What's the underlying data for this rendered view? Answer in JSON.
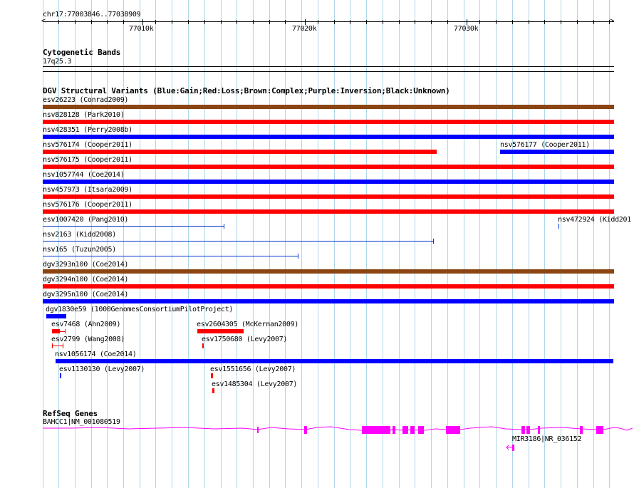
{
  "location": "chr17:77003846..77038909",
  "ruler": {
    "ticks": [
      "77010k",
      "77020k",
      "77030k"
    ]
  },
  "colors": {
    "gain": "#0000ff",
    "loss": "#ff0000",
    "complex": "#8b4513",
    "thin_gain": "#0033cc",
    "gene": "#ff00ff",
    "grid": "#add8e6"
  },
  "cytoband": {
    "title": "Cytogenetic Bands",
    "band": "17q25.3"
  },
  "dgv": {
    "title": "DGV Structural Variants (Blue:Gain;Red:Loss;Brown:Complex;Purple:Inversion;Black:Unknown)",
    "variants": [
      {
        "label": "esv26223 (Conrad2009)",
        "type": "complex"
      },
      {
        "label": "nsv828128 (Park2010)",
        "type": "loss"
      },
      {
        "label": "nsv428351 (Perry2008b)",
        "type": "gain"
      },
      {
        "label": "nsv576174 (Cooper2011)",
        "type": "loss"
      },
      {
        "label": "nsv576177 (Cooper2011)",
        "type": "gain"
      },
      {
        "label": "nsv576175 (Cooper2011)",
        "type": "loss"
      },
      {
        "label": "nsv1057744 (Coe2014)",
        "type": "gain"
      },
      {
        "label": "nsv457973 (Itsara2009)",
        "type": "loss"
      },
      {
        "label": "nsv576176 (Cooper2011)",
        "type": "loss"
      },
      {
        "label": "esv1007420 (Pang2010)",
        "type": "gain"
      },
      {
        "label": "nsv472924 (Kidd201",
        "type": "gain"
      },
      {
        "label": "nsv2163 (Kidd2008)",
        "type": "gain"
      },
      {
        "label": "nsv165 (Tuzun2005)",
        "type": "gain"
      },
      {
        "label": "dgv3293n100 (Coe2014)",
        "type": "complex"
      },
      {
        "label": "dgv3294n100 (Coe2014)",
        "type": "loss"
      },
      {
        "label": "dgv3295n100 (Coe2014)",
        "type": "gain"
      },
      {
        "label": "dgv1830e59 (1000GenomesConsortiumPilotProject)",
        "type": "gain"
      },
      {
        "label": "esv7468 (Ahn2009)",
        "type": "loss"
      },
      {
        "label": "esv2604305 (McKernan2009)",
        "type": "loss"
      },
      {
        "label": "esv2799 (Wang2008)",
        "type": "loss"
      },
      {
        "label": "esv1750680 (Levy2007)",
        "type": "loss"
      },
      {
        "label": "nsv1056174 (Coe2014)",
        "type": "gain"
      },
      {
        "label": "esv1130130 (Levy2007)",
        "type": "gain"
      },
      {
        "label": "esv1551656 (Levy2007)",
        "type": "loss"
      },
      {
        "label": "esv1485304 (Levy2007)",
        "type": "loss"
      }
    ]
  },
  "refseq": {
    "title": "RefSeq Genes",
    "genes": [
      {
        "label": "BAHCC1|NM_001080519"
      },
      {
        "label": "MIR3186|NR_036152"
      }
    ]
  }
}
